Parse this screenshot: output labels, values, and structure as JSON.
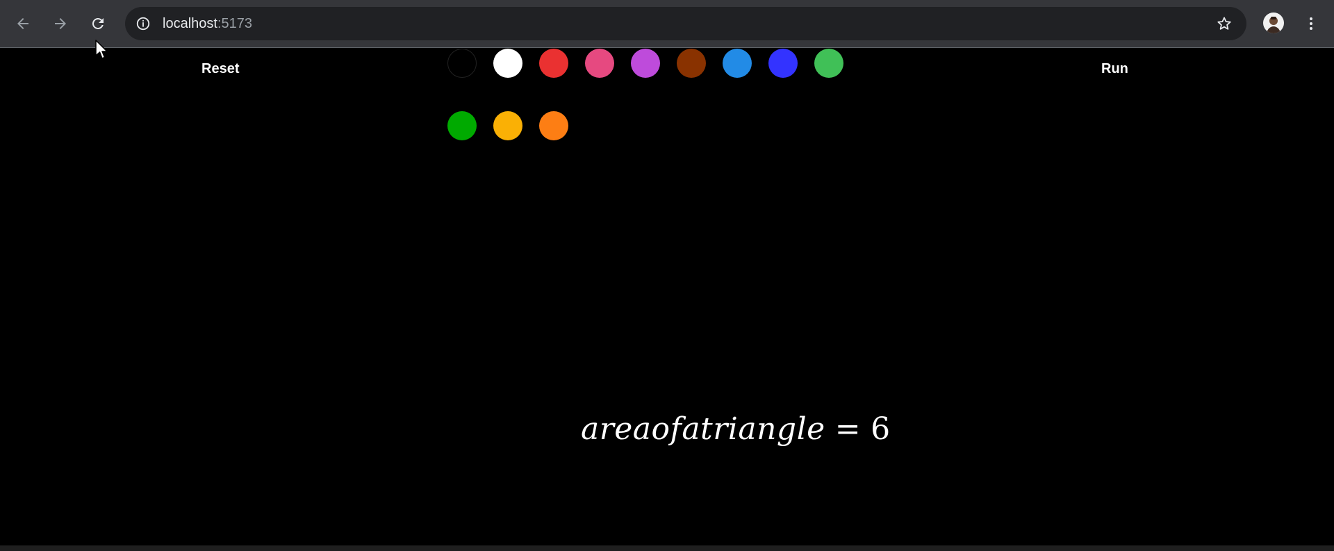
{
  "browser": {
    "url_host": "localhost",
    "url_port": ":5173",
    "icons": {
      "back": "arrow-left-icon",
      "forward": "arrow-right-icon",
      "reload": "reload-icon",
      "info": "info-icon",
      "bookmark": "star-icon",
      "profile": "avatar",
      "menu": "kebab-menu-icon"
    }
  },
  "toolbar": {
    "reset_label": "Reset",
    "run_label": "Run"
  },
  "palette": {
    "colors": [
      "#000000",
      "#ffffff",
      "#ea3131",
      "#e64980",
      "#be4bdb",
      "#893200",
      "#228be6",
      "#3333ff",
      "#40c057",
      "#00aa00",
      "#fab005",
      "#fd7e14"
    ]
  },
  "canvas": {
    "formula_left": "areaofatriangle",
    "formula_eq": "=",
    "formula_right": "6"
  }
}
